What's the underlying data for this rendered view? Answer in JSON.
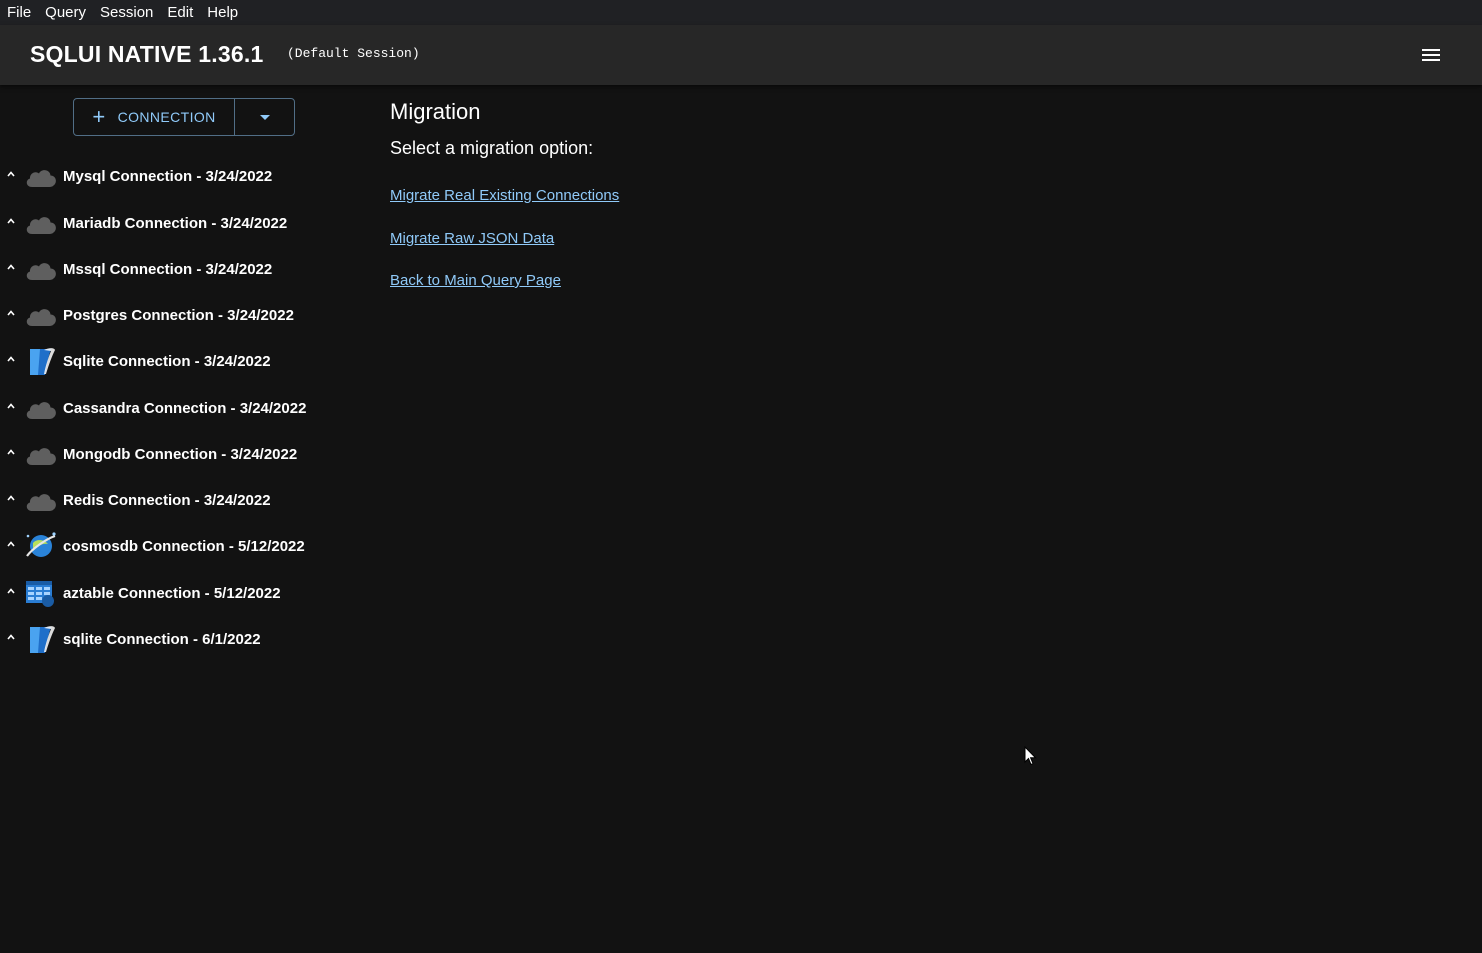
{
  "menubar": {
    "items": [
      "File",
      "Query",
      "Session",
      "Edit",
      "Help"
    ]
  },
  "appbar": {
    "title": "SQLUI NATIVE 1.36.1",
    "session": "(Default Session)",
    "menu_icon": "hamburger-menu-icon"
  },
  "sidebar": {
    "add_button_label": "CONNECTION",
    "add_icon": "plus-icon",
    "dropdown_icon": "caret-down-icon",
    "connections": [
      {
        "label": "Mysql Connection - 3/24/2022",
        "icon": "cloud-icon"
      },
      {
        "label": "Mariadb Connection - 3/24/2022",
        "icon": "cloud-icon"
      },
      {
        "label": "Mssql Connection - 3/24/2022",
        "icon": "cloud-icon"
      },
      {
        "label": "Postgres Connection - 3/24/2022",
        "icon": "cloud-icon"
      },
      {
        "label": "Sqlite Connection - 3/24/2022",
        "icon": "sqlite-icon"
      },
      {
        "label": "Cassandra Connection - 3/24/2022",
        "icon": "cloud-icon"
      },
      {
        "label": "Mongodb Connection - 3/24/2022",
        "icon": "cloud-icon"
      },
      {
        "label": "Redis Connection - 3/24/2022",
        "icon": "cloud-icon"
      },
      {
        "label": "cosmosdb Connection - 5/12/2022",
        "icon": "cosmosdb-icon"
      },
      {
        "label": "aztable Connection - 5/12/2022",
        "icon": "aztable-icon"
      },
      {
        "label": "sqlite Connection - 6/1/2022",
        "icon": "sqlite-icon"
      }
    ]
  },
  "main": {
    "title": "Migration",
    "subtitle": "Select a migration option:",
    "links": [
      "Migrate Real Existing Connections",
      "Migrate Raw JSON Data",
      "Back to Main Query Page"
    ]
  },
  "colors": {
    "background": "#121212",
    "appbar": "#272727",
    "menubar": "#202124",
    "accent": "#90caf9",
    "cloud": "#5f5f5f"
  }
}
